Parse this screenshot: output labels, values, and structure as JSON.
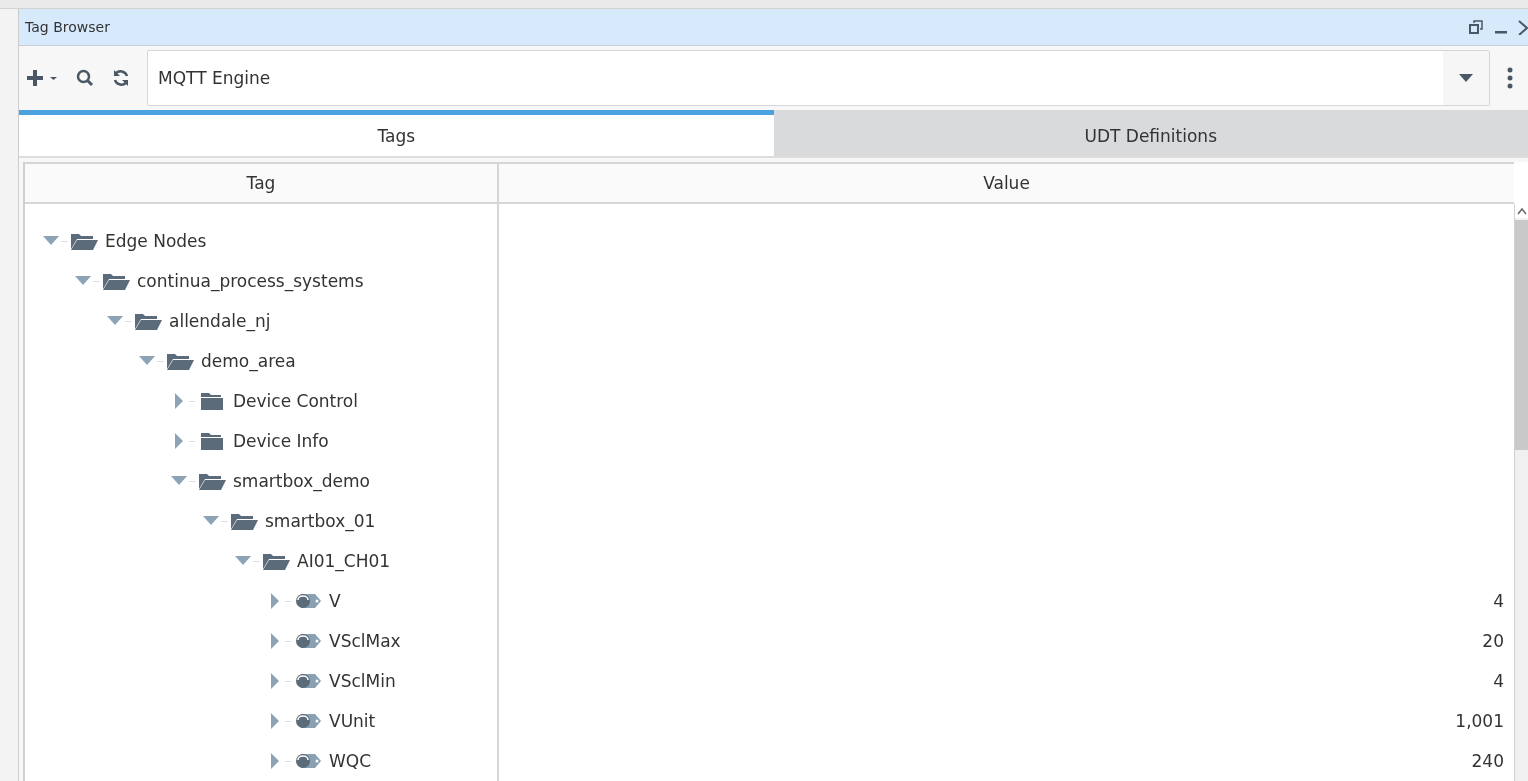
{
  "window": {
    "title": "Tag Browser"
  },
  "toolbar": {
    "provider": "MQTT Engine"
  },
  "tabs": [
    {
      "label": "Tags",
      "selected": true
    },
    {
      "label": "UDT Definitions",
      "selected": false
    }
  ],
  "table": {
    "columns": [
      "Tag",
      "Value"
    ],
    "tree": [
      {
        "label": "Edge Nodes",
        "kind": "folder",
        "expanded": true,
        "children": [
          {
            "label": "continua_process_systems",
            "kind": "folder",
            "expanded": true,
            "children": [
              {
                "label": "allendale_nj",
                "kind": "folder",
                "expanded": true,
                "children": [
                  {
                    "label": "demo_area",
                    "kind": "folder",
                    "expanded": true,
                    "children": [
                      {
                        "label": "Device Control",
                        "kind": "folder",
                        "expanded": false
                      },
                      {
                        "label": "Device Info",
                        "kind": "folder",
                        "expanded": false
                      },
                      {
                        "label": "smartbox_demo",
                        "kind": "folder",
                        "expanded": true,
                        "children": [
                          {
                            "label": "smartbox_01",
                            "kind": "folder",
                            "expanded": true,
                            "children": [
                              {
                                "label": "AI01_CH01",
                                "kind": "folder",
                                "expanded": true,
                                "children": [
                                  {
                                    "label": "V",
                                    "kind": "tag",
                                    "expanded": false,
                                    "value": "4"
                                  },
                                  {
                                    "label": "VSclMax",
                                    "kind": "tag",
                                    "expanded": false,
                                    "value": "20"
                                  },
                                  {
                                    "label": "VSclMin",
                                    "kind": "tag",
                                    "expanded": false,
                                    "value": "4"
                                  },
                                  {
                                    "label": "VUnit",
                                    "kind": "tag",
                                    "expanded": false,
                                    "value": "1,001"
                                  },
                                  {
                                    "label": "WQC",
                                    "kind": "tag",
                                    "expanded": false,
                                    "value": "240"
                                  }
                                ]
                              }
                            ]
                          }
                        ]
                      }
                    ]
                  }
                ]
              }
            ]
          }
        ]
      }
    ]
  }
}
